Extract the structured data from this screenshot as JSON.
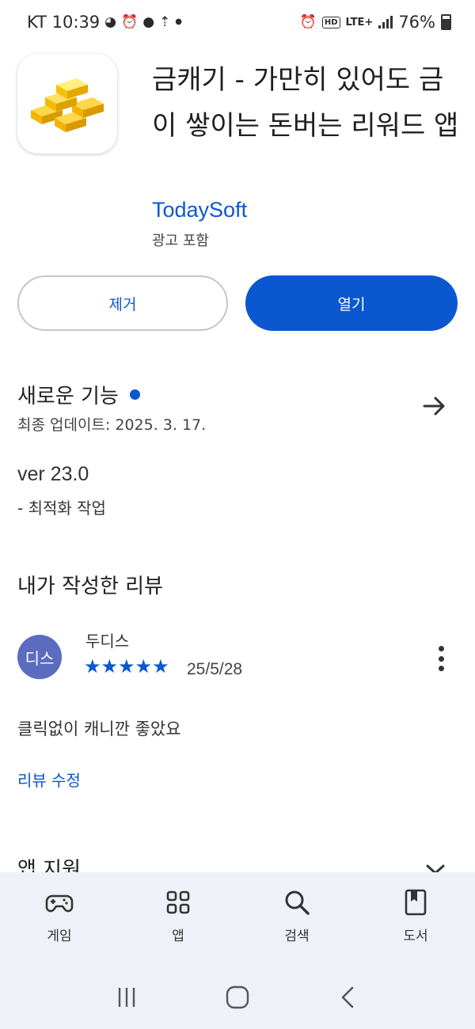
{
  "status_bar": {
    "carrier_time": "KT 10:39",
    "network": "LTE+",
    "battery": "76%"
  },
  "app": {
    "title": "금캐기 - 가만히 있어도 금이 쌓이는 돈버는 리워드 앱",
    "developer": "TodaySoft",
    "ads_label": "광고 포함",
    "icon": "gold-bars-icon"
  },
  "actions": {
    "remove_label": "제거",
    "open_label": "열기"
  },
  "whats_new": {
    "title": "새로운 기능",
    "last_updated": "최종 업데이트: 2025. 3. 17.",
    "version": "ver 23.0",
    "notes": "- 최적화 작업"
  },
  "my_review": {
    "heading": "내가 작성한 리뷰",
    "avatar_text": "디스",
    "reviewer": "두디스",
    "rating": 5,
    "stars": "★★★★★",
    "date": "25/5/28",
    "text": "클릭없이 캐니깐 좋았요",
    "edit_label": "리뷰 수정"
  },
  "app_support": {
    "heading": "앱 지원"
  },
  "bottom_nav": {
    "items": [
      {
        "label": "게임",
        "icon": "gamepad-icon"
      },
      {
        "label": "앱",
        "icon": "apps-grid-icon"
      },
      {
        "label": "검색",
        "icon": "search-icon"
      },
      {
        "label": "도서",
        "icon": "book-icon"
      }
    ]
  },
  "colors": {
    "accent": "#0b57d0",
    "avatar": "#5b6bc0",
    "nav_bg": "#eef1f8"
  }
}
